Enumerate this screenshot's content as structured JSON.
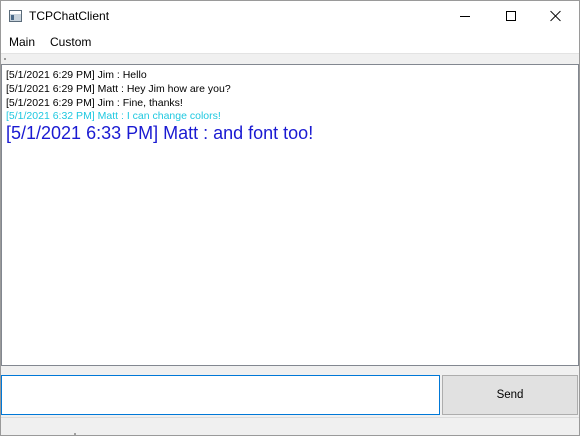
{
  "window": {
    "title": "TCPChatClient"
  },
  "menu": {
    "items": [
      "Main",
      "Custom"
    ]
  },
  "chat": {
    "messages": [
      {
        "text": "[5/1/2021 6:29 PM] Jim : Hello",
        "color": "#000000",
        "size": "small"
      },
      {
        "text": "[5/1/2021 6:29 PM] Matt : Hey Jim how are you?",
        "color": "#000000",
        "size": "small"
      },
      {
        "text": "[5/1/2021 6:29 PM] Jim : Fine, thanks!",
        "color": "#000000",
        "size": "small"
      },
      {
        "text": "[5/1/2021 6:32 PM] Matt : I can change colors!",
        "color": "#1ec8e0",
        "size": "small"
      },
      {
        "text": "[5/1/2021 6:33 PM] Matt : and font too!",
        "color": "#1a1ad2",
        "size": "big"
      }
    ]
  },
  "compose": {
    "input_value": "",
    "send_label": "Send"
  },
  "colors": {
    "input_focus_border": "#0078d7",
    "button_bg": "#e1e1e1"
  }
}
